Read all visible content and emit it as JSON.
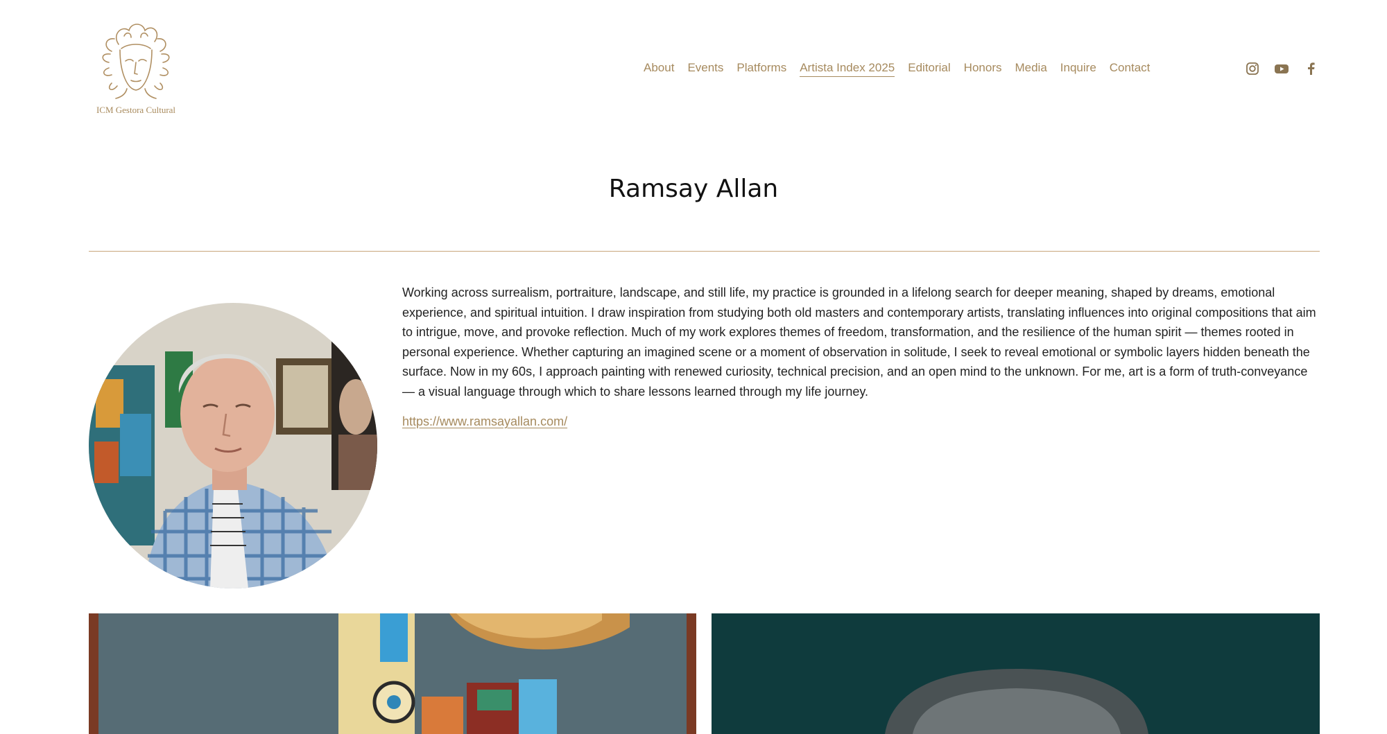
{
  "brand": {
    "name": "ICM Gestora Cultural",
    "color": "#a88a5c"
  },
  "nav": {
    "items": [
      {
        "label": "About"
      },
      {
        "label": "Events"
      },
      {
        "label": "Platforms"
      },
      {
        "label": "Artista Index 2025",
        "active": true
      },
      {
        "label": "Editorial"
      },
      {
        "label": "Honors"
      },
      {
        "label": "Media"
      },
      {
        "label": "Inquire"
      },
      {
        "label": "Contact"
      }
    ],
    "color": "#a68a5e"
  },
  "social": {
    "icons": [
      "instagram-icon",
      "youtube-icon",
      "facebook-icon"
    ]
  },
  "artist": {
    "name": "Ramsay Allan",
    "bio": "Working across surrealism, portraiture, landscape, and still life, my practice is grounded in a lifelong search for deeper meaning, shaped by dreams, emotional experience, and spiritual intuition. I draw inspiration from studying both old masters and contemporary artists, translating influences into original compositions that aim to intrigue, move, and provoke reflection. Much of my work explores themes of freedom, transformation, and the resilience of the human spirit — themes rooted in personal experience. Whether capturing an imagined scene or a moment of observation in solitude, I seek to reveal emotional or symbolic layers hidden beneath the surface. Now in my 60s, I approach painting with renewed curiosity, technical precision, and an open mind to the unknown. For me, art is a form of truth-conveyance — a visual language through which to share lessons learned through my life journey.",
    "website": "https://www.ramsayallan.com/"
  },
  "accent_divider_color": "#c8a57b"
}
